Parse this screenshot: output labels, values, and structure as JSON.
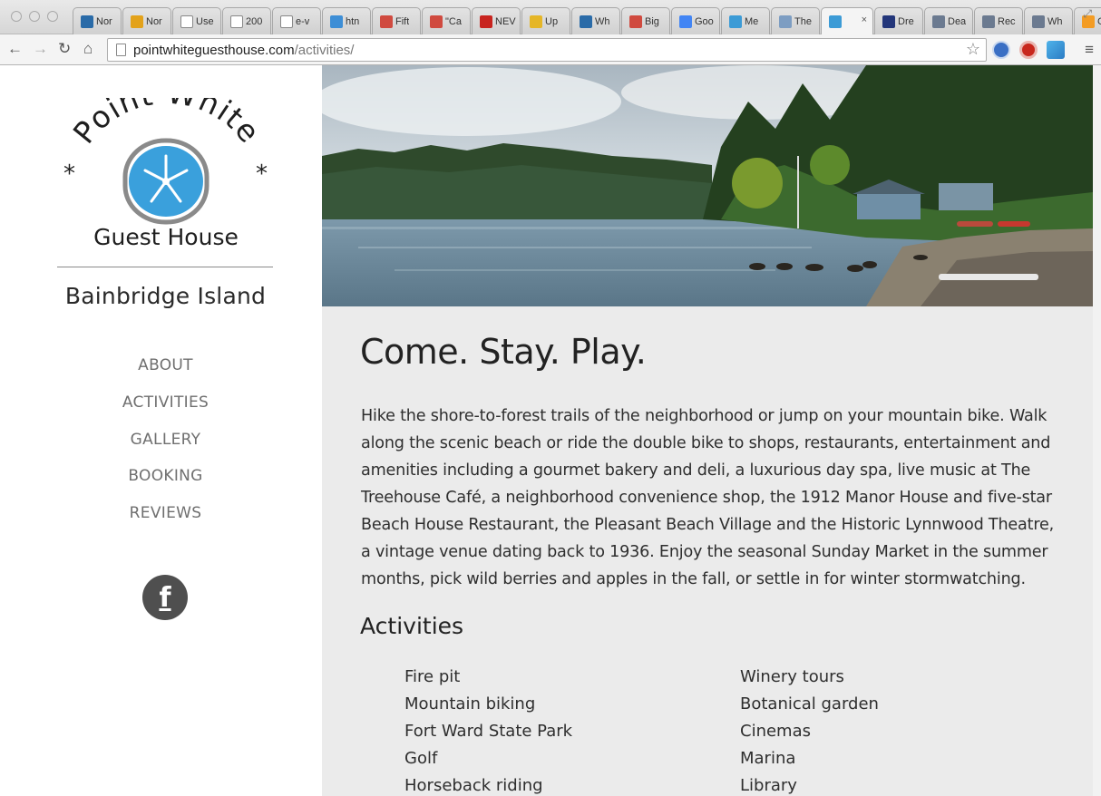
{
  "browser": {
    "tabs": [
      {
        "title": "Nor",
        "icon": "tab-favicon-compass",
        "color": "#2a6ba8"
      },
      {
        "title": "Nor",
        "icon": "tab-favicon-sun",
        "color": "#e3a21a"
      },
      {
        "title": "Use",
        "icon": "tab-favicon-page",
        "color": "#ffffff"
      },
      {
        "title": "200",
        "icon": "tab-favicon-page",
        "color": "#ffffff"
      },
      {
        "title": "e-v",
        "icon": "tab-favicon-page",
        "color": "#ffffff"
      },
      {
        "title": "htn",
        "icon": "tab-favicon-globe",
        "color": "#3d8ed6"
      },
      {
        "title": "Fift",
        "icon": "tab-favicon-red",
        "color": "#d04a3f"
      },
      {
        "title": "\"Ca",
        "icon": "tab-favicon-red",
        "color": "#d04a3f"
      },
      {
        "title": "NEV",
        "icon": "tab-favicon-news",
        "color": "#c8241f"
      },
      {
        "title": "Up",
        "icon": "tab-favicon-up",
        "color": "#e5b627"
      },
      {
        "title": "Wh",
        "icon": "tab-favicon-compass",
        "color": "#2a6ba8"
      },
      {
        "title": "Big",
        "icon": "tab-favicon-red",
        "color": "#d04a3f"
      },
      {
        "title": "Goo",
        "icon": "tab-favicon-google",
        "color": "#4285f4"
      },
      {
        "title": "Me",
        "icon": "tab-favicon-sanddollar",
        "color": "#3c9bd6"
      },
      {
        "title": "The",
        "icon": "tab-favicon-doc",
        "color": "#7d9dc2"
      },
      {
        "title": "",
        "icon": "tab-favicon-sanddollar",
        "color": "#3c9bd6",
        "active": true
      },
      {
        "title": "Dre",
        "icon": "tab-favicon-moon",
        "color": "#23367a"
      },
      {
        "title": "Dea",
        "icon": "tab-favicon-img",
        "color": "#6b7a90"
      },
      {
        "title": "Rec",
        "icon": "tab-favicon-img",
        "color": "#6b7a90"
      },
      {
        "title": "Wh",
        "icon": "tab-favicon-img",
        "color": "#6b7a90"
      },
      {
        "title": "Goo",
        "icon": "tab-favicon-chart",
        "color": "#f39c24"
      }
    ],
    "url_domain": "pointwhiteguesthouse.com",
    "url_path": "/activities/"
  },
  "sidebar": {
    "logo_arc_text": "Point White",
    "logo_bottom_text": "Guest House",
    "tagline": "Bainbridge Island",
    "nav": [
      "ABOUT",
      "ACTIVITIES",
      "GALLERY",
      "BOOKING",
      "REVIEWS"
    ],
    "facebook_glyph": "f"
  },
  "main": {
    "headline": "Come. Stay. Play.",
    "intro": "Hike the shore-to-forest trails of the neighborhood or jump on your mountain bike. Walk along the scenic beach or ride the double bike to shops, restaurants, entertainment and amenities including a gourmet bakery and deli, a luxurious day spa, live music at The Treehouse Café, a neighborhood convenience shop, the 1912 Manor House and five-star Beach House Restaurant, the Pleasant Beach Village and the Historic Lynnwood Theatre, a vintage venue dating back to 1936. Enjoy the seasonal Sunday Market in the summer months, pick wild berries and apples in the fall, or settle in for winter stormwatching.",
    "activities_heading": "Activities",
    "activities_left": [
      "Fire pit",
      "Mountain biking",
      "Fort Ward State Park",
      "Golf",
      "Horseback riding"
    ],
    "activities_right": [
      "Winery tours",
      "Botanical garden",
      "Cinemas",
      "Marina",
      "Library"
    ]
  },
  "colors": {
    "logo_blue": "#3aa0dc",
    "content_bg": "#ebebeb",
    "nav_text": "#6f6f6f"
  }
}
